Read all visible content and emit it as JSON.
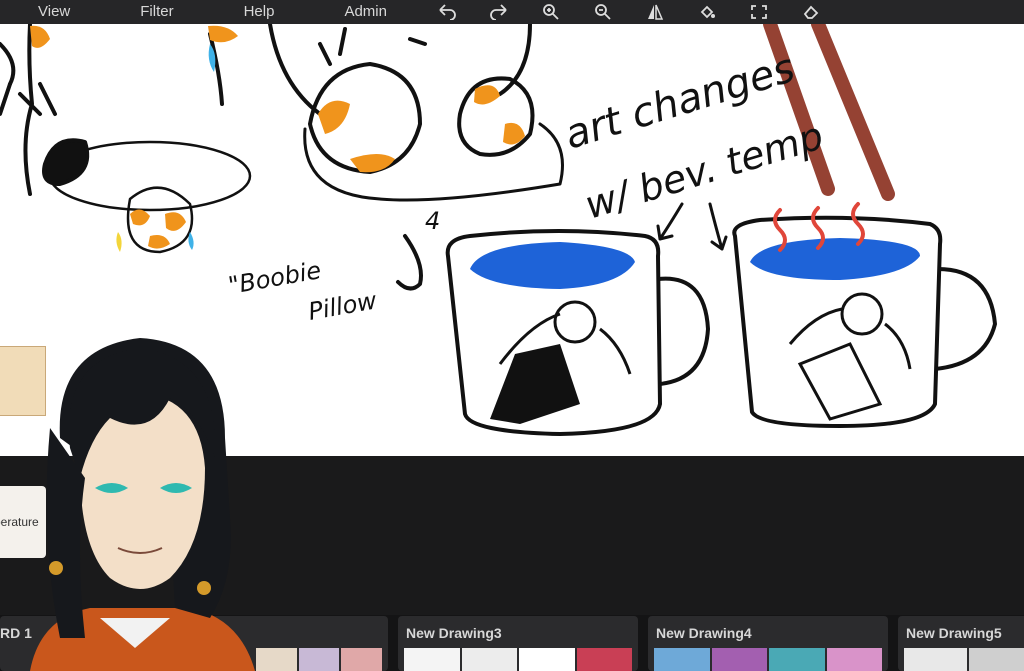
{
  "menu": {
    "items": [
      {
        "label": "View"
      },
      {
        "label": "Filter"
      },
      {
        "label": "Help"
      },
      {
        "label": "Admin"
      }
    ]
  },
  "toolbar": {
    "icons": [
      "undo-icon",
      "redo-icon",
      "zoom-in-icon",
      "zoom-out-icon",
      "flip-icon",
      "fill-icon",
      "fullscreen-icon",
      "eraser-icon"
    ]
  },
  "canvas": {
    "annotations": {
      "line1": "art changes",
      "line2": "w/ bev. temp",
      "label1": "\"Boobie",
      "label2": "Pillow",
      "number": "4"
    }
  },
  "side_panel": {
    "card_text": "perature"
  },
  "boards": [
    {
      "title": "RD 1"
    },
    {
      "title": "New Drawing3"
    },
    {
      "title": "New Drawing4"
    },
    {
      "title": "New Drawing5"
    }
  ],
  "colors": {
    "menubar": "#262628",
    "canvas": "#ffffff",
    "water": "#1e63d8",
    "accent_orange": "#f0941c",
    "steam": "#e0463a",
    "bg_dark": "#1a1a1b"
  }
}
